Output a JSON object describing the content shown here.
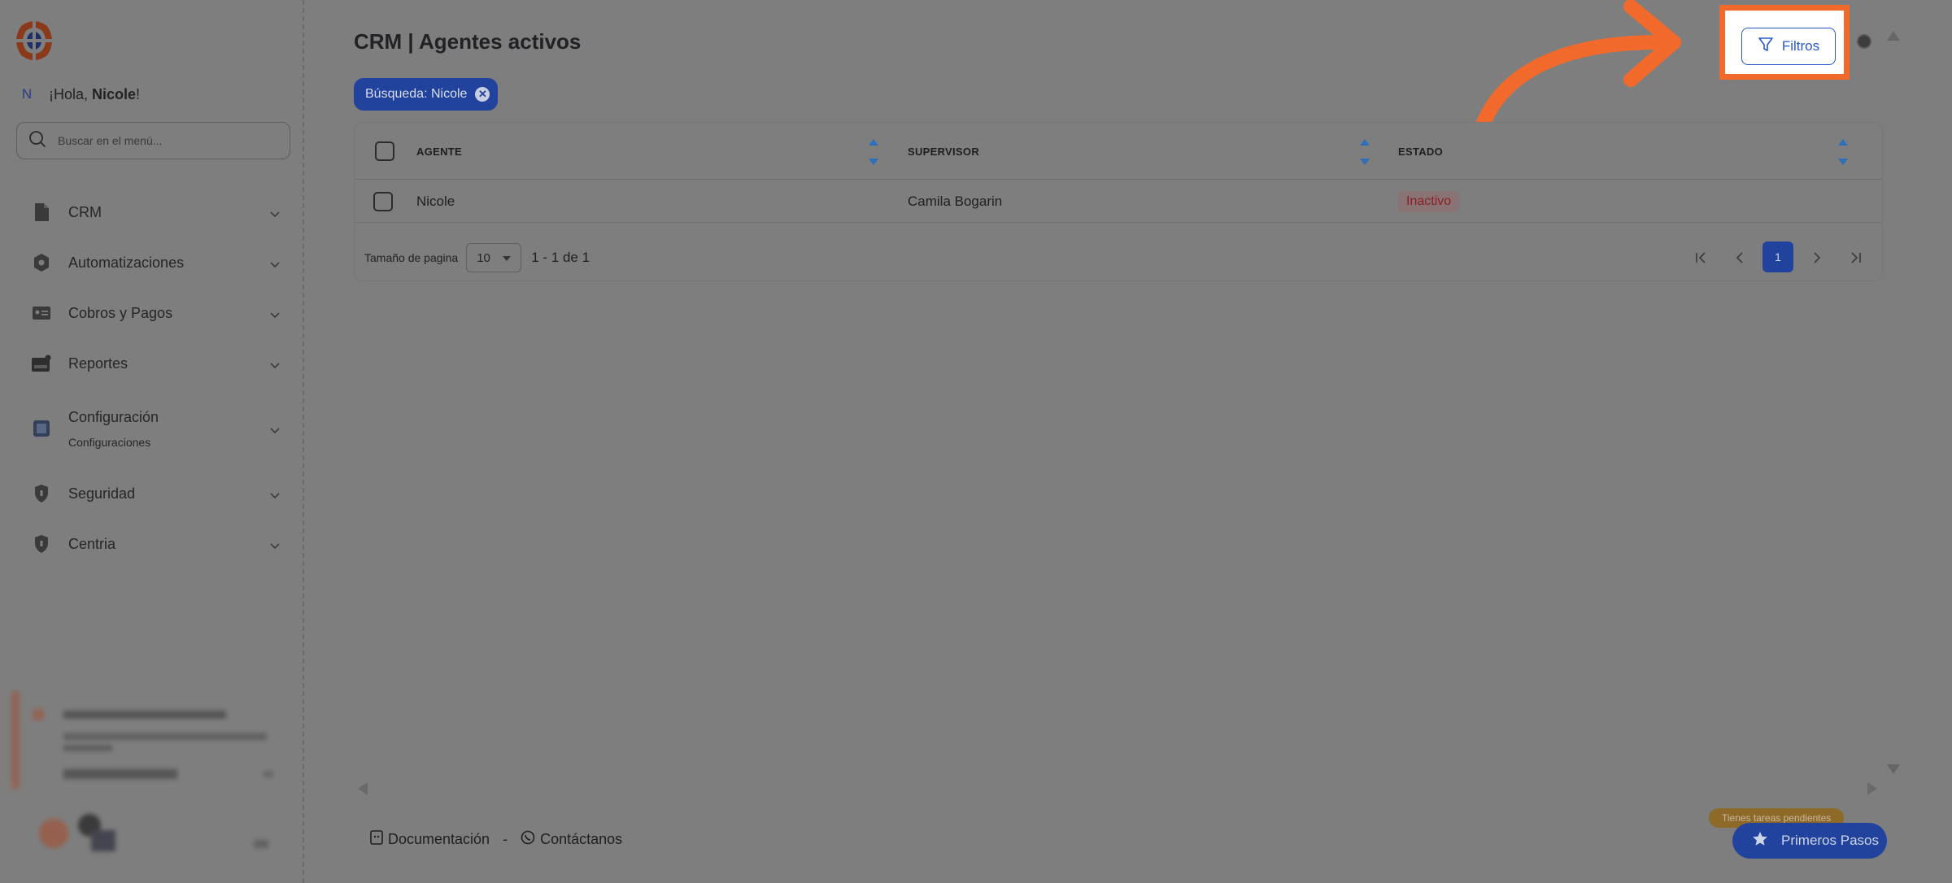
{
  "sidebar": {
    "greeting_prefix": "¡Hola, ",
    "user_name": "Nicole",
    "greeting_suffix": "!",
    "avatar_initial": "N",
    "search_placeholder": "Buscar en el menú...",
    "items": [
      {
        "label": "CRM",
        "icon": "document-icon"
      },
      {
        "label": "Automatizaciones",
        "icon": "gear-icon"
      },
      {
        "label": "Cobros y Pagos",
        "icon": "id-card-icon"
      },
      {
        "label": "Reportes",
        "icon": "report-icon"
      },
      {
        "label": "Configuración",
        "sub": "Configuraciones",
        "icon": "book-icon"
      },
      {
        "label": "Seguridad",
        "icon": "shield-icon"
      },
      {
        "label": "Centria",
        "icon": "shield-icon"
      }
    ]
  },
  "header": {
    "title": "CRM | Agentes activos",
    "filter_label": "Filtros"
  },
  "search_chip": {
    "label": "Búsqueda: Nicole"
  },
  "table": {
    "columns": [
      "AGENTE",
      "SUPERVISOR",
      "ESTADO"
    ],
    "rows": [
      {
        "agente": "Nicole",
        "supervisor": "Camila Bogarin",
        "estado": "Inactivo"
      }
    ]
  },
  "pagination": {
    "page_size_label": "Tamaño de pagina",
    "page_size": "10",
    "range": "1 - 1 de 1",
    "current_page": "1"
  },
  "footer": {
    "docs_label": "Documentación",
    "separator": "-",
    "contact_label": "Contáctanos"
  },
  "onboarding": {
    "tasks_badge": "Tienes tareas pendientes",
    "button_label": "Primeros Pasos"
  },
  "colors": {
    "accent": "#21439d",
    "highlight": "#f26a2b",
    "danger": "#8a1f25"
  }
}
